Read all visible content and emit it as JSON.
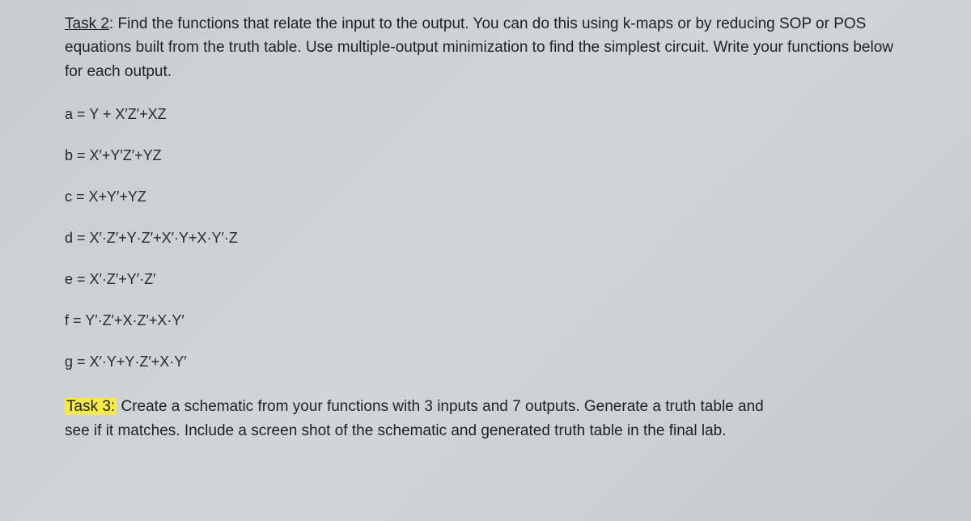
{
  "task2": {
    "label": "Task 2",
    "description": ": Find the functions that relate the input to the output.  You can do this using k-maps or by reducing SOP or POS equations built from the truth table.  Use multiple-output minimization to find the simplest circuit.  Write your functions below for each output."
  },
  "equations": {
    "a": "a = Y + X′Z′+XZ",
    "b": "b = X′+Y′Z′+YZ",
    "c": "c = X+Y′+YZ",
    "d": "d = X′·Z′+Y·Z′+X′·Y+X·Y′·Z",
    "e": "e = X′·Z′+Y′·Z′",
    "f": "f = Y′·Z′+X·Z′+X·Y′",
    "g": "g = X′·Y+Y·Z′+X·Y′"
  },
  "task3": {
    "label": "Task 3:",
    "description_part1": " Create a schematic from your functions with 3 inputs and 7 outputs.  Generate a truth table and",
    "description_part2": "see if it matches.  Include a screen shot of the schematic and generated truth table in the final lab."
  }
}
